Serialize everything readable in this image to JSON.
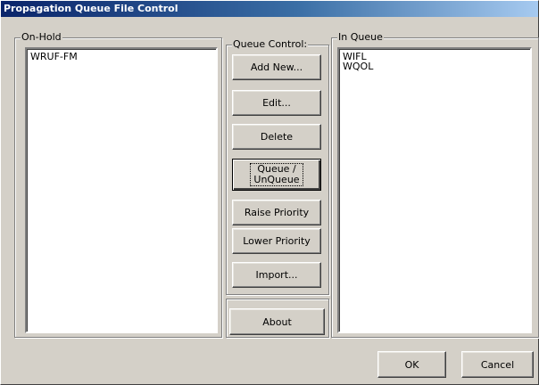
{
  "window": {
    "title": "Propagation Queue File Control"
  },
  "on_hold": {
    "label": "On-Hold",
    "items": [
      "WRUF-FM"
    ]
  },
  "queue_control": {
    "label": "Queue Control:",
    "buttons": {
      "add_new": "Add New...",
      "edit": "Edit...",
      "delete": "Delete",
      "queue_line1": "Queue /",
      "queue_line2": "UnQueue",
      "raise_priority": "Raise Priority",
      "lower_priority": "Lower Priority",
      "import": "Import..."
    },
    "about": "About"
  },
  "in_queue": {
    "label": "In Queue",
    "items": [
      "WIFL",
      "WQOL"
    ]
  },
  "footer": {
    "ok": "OK",
    "cancel": "Cancel"
  },
  "colors": {
    "face": "#d4d0c8",
    "title_start": "#0a246a",
    "title_end": "#a6caf0"
  }
}
